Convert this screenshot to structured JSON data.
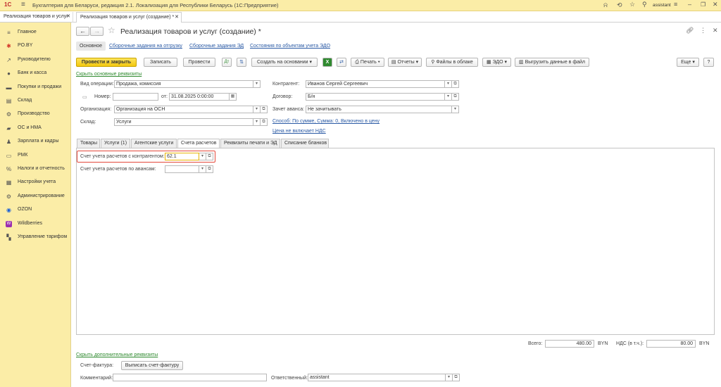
{
  "app": {
    "title": "Бухгалтерия для Беларуси, редакция 2.1. Локализация для Республики Беларусь   (1С:Предприятие)",
    "user": "assistant"
  },
  "tabs": [
    "Реализация товаров и услуг",
    "Реализация товаров и услуг (создание) *"
  ],
  "sidebar": {
    "items": [
      {
        "label": "Главное",
        "icon": "≡"
      },
      {
        "label": "PO.BY",
        "icon": "✱"
      },
      {
        "label": "Руководителю",
        "icon": "↗"
      },
      {
        "label": "Банк и касса",
        "icon": "●"
      },
      {
        "label": "Покупки и продажи",
        "icon": "▬"
      },
      {
        "label": "Склад",
        "icon": "▤"
      },
      {
        "label": "Производство",
        "icon": "⚙"
      },
      {
        "label": "ОС и НМА",
        "icon": "▰"
      },
      {
        "label": "Зарплата и кадры",
        "icon": "♟"
      },
      {
        "label": "РМК",
        "icon": "▭"
      },
      {
        "label": "Налоги и отчетность",
        "icon": "%"
      },
      {
        "label": "Настройки учета",
        "icon": "▦"
      },
      {
        "label": "Администрирование",
        "icon": "⚙"
      },
      {
        "label": "OZON",
        "icon": "◉"
      },
      {
        "label": "Wildberries",
        "icon": "W"
      },
      {
        "label": "Управление тарифом",
        "icon": "▚"
      }
    ]
  },
  "doc": {
    "title": "Реализация товаров и услуг (создание) *",
    "subnav": [
      "Основное",
      "Сборочные задания на отгрузку",
      "Сборочные задания ЭД",
      "Состояния по объектам учета ЭДО"
    ],
    "toolbar": {
      "post_close": "Провести и закрыть",
      "save": "Записать",
      "post": "Провести",
      "create_basis": "Создать на основании",
      "print": "Печать",
      "reports": "Отчеты",
      "cloud": "Файлы в облаке",
      "edo": "ЭДО",
      "export": "Выгрузить данные в файл",
      "more": "Еще",
      "help": "?"
    },
    "hide_link": "Скрыть основные реквизиты",
    "fields": {
      "op_label": "Вид операции:",
      "op_value": "Продажа, комиссия",
      "num_label": "Номер:",
      "num_value": "",
      "date_label": "от:",
      "date_value": "31.08.2025  0:00:00",
      "org_label": "Организация:",
      "org_value": "Организация на ОСН",
      "wh_label": "Склад:",
      "wh_value": "Услуги",
      "cp_label": "Контрагент:",
      "cp_value": "Иванов Сергей Сергеевич",
      "ct_label": "Договор:",
      "ct_value": "Б/н",
      "adv_label": "Зачет аванса:",
      "adv_value": "Не зачитывать",
      "method_link": "Способ: По сумме, Сумма: 0, Включено в цену",
      "vat_link": "Цена не включает НДС"
    },
    "form_tabs": [
      "Товары",
      "Услуги (1)",
      "Агентские услуги",
      "Счета расчетов",
      "Реквизиты печати и ЭД",
      "Списание бланков"
    ],
    "accounts": {
      "cp_label": "Счет учета расчетов с контрагентом:",
      "cp_value": "62.1",
      "adv_label": "Счет учета расчетов по авансам:",
      "adv_value": ""
    },
    "totals": {
      "total_label": "Всего:",
      "total_value": "480.00",
      "currency": "BYN",
      "vat_label": "НДС (в т.ч.):",
      "vat_value": "80.00"
    },
    "footer": {
      "more_link": "Скрыть дополнительные реквизиты",
      "invoice_label": "Счет-фактура:",
      "invoice_button": "Выписать счет-фактуру",
      "comment_label": "Комментарий:",
      "comment_value": "",
      "resp_label": "Ответственный:",
      "resp_value": "assistant"
    }
  },
  "colors": {
    "accent": "#f3c80d",
    "highlight": "#e3483a",
    "sidebar": "#fbeda7",
    "link": "#2a5aa5"
  }
}
